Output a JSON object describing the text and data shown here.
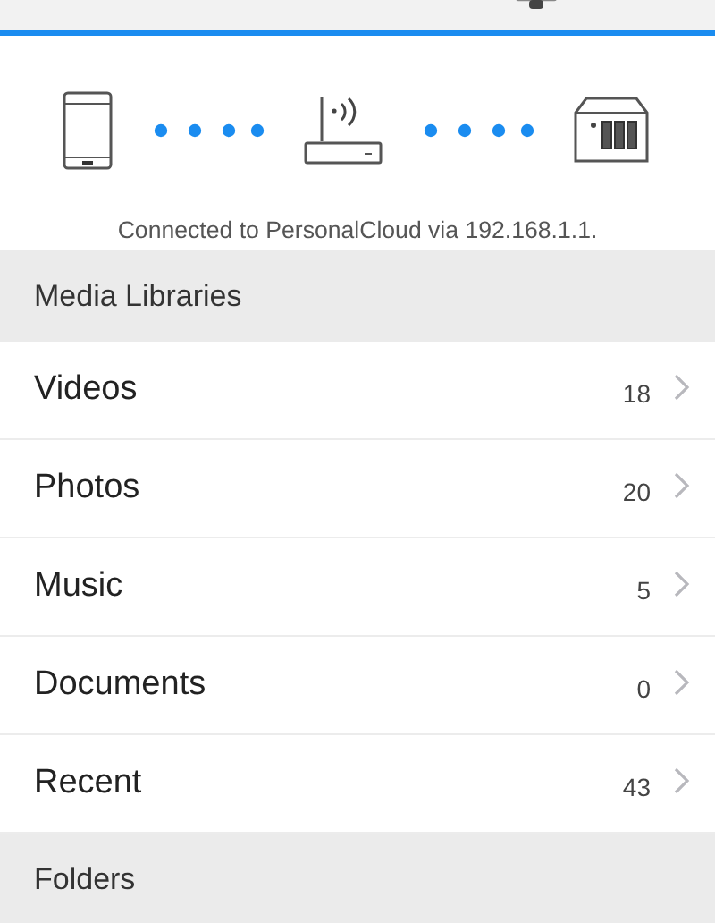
{
  "connection": {
    "status": "Connected to PersonalCloud via 192.168.1.1."
  },
  "sections": [
    {
      "title": "Media Libraries",
      "items": [
        {
          "label": "Videos",
          "count": "18"
        },
        {
          "label": "Photos",
          "count": "20"
        },
        {
          "label": "Music",
          "count": "5"
        },
        {
          "label": "Documents",
          "count": "0"
        },
        {
          "label": "Recent",
          "count": "43"
        }
      ]
    },
    {
      "title": "Folders"
    }
  ]
}
